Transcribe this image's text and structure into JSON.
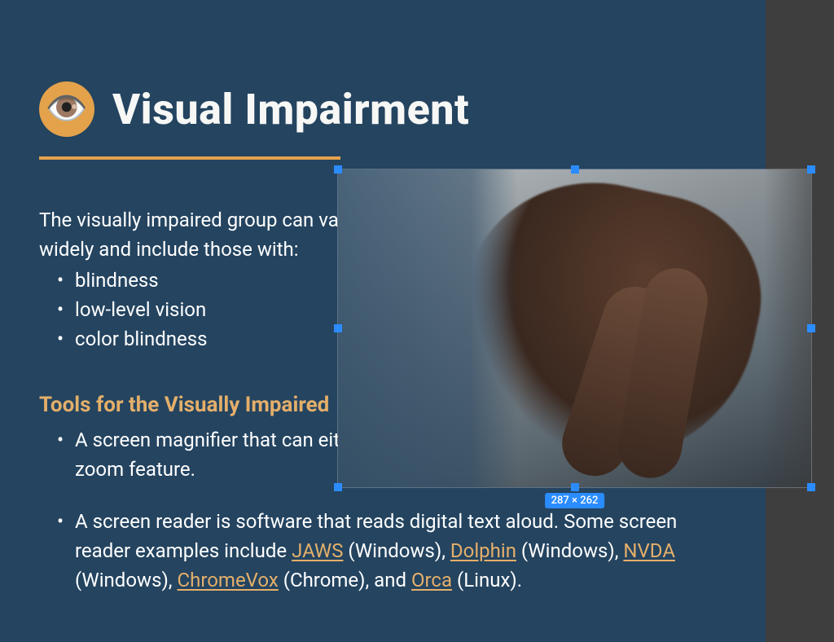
{
  "slide": {
    "title": "Visual Impairment",
    "icon_name": "eye-icon",
    "icon_glyph": "👁️",
    "accent_color": "#e4a24b",
    "intro": "The visually impaired group can vary widely and include those with:",
    "impairments": [
      "blindness",
      "low-level vision",
      "color blindness"
    ],
    "tools_heading": "Tools for the Visually Impaired",
    "tools": [
      {
        "text": "A screen magnifier that can either be a physical magnifier or a software zoom feature.",
        "links": []
      },
      {
        "text_parts": [
          "A screen reader is software that reads digital text aloud. Some screen reader examples include ",
          {
            "link": "JAWS"
          },
          " (Windows), ",
          {
            "link": "Dolphin"
          },
          " (Windows), ",
          {
            "link": "NVDA"
          },
          " (Windows), ",
          {
            "link": "ChromeVox"
          },
          " (Chrome), and ",
          {
            "link": "Orca"
          },
          " (Linux)."
        ]
      }
    ],
    "image": {
      "alt": "Fingers reading braille on a page",
      "selection_size": "287 × 262"
    }
  }
}
